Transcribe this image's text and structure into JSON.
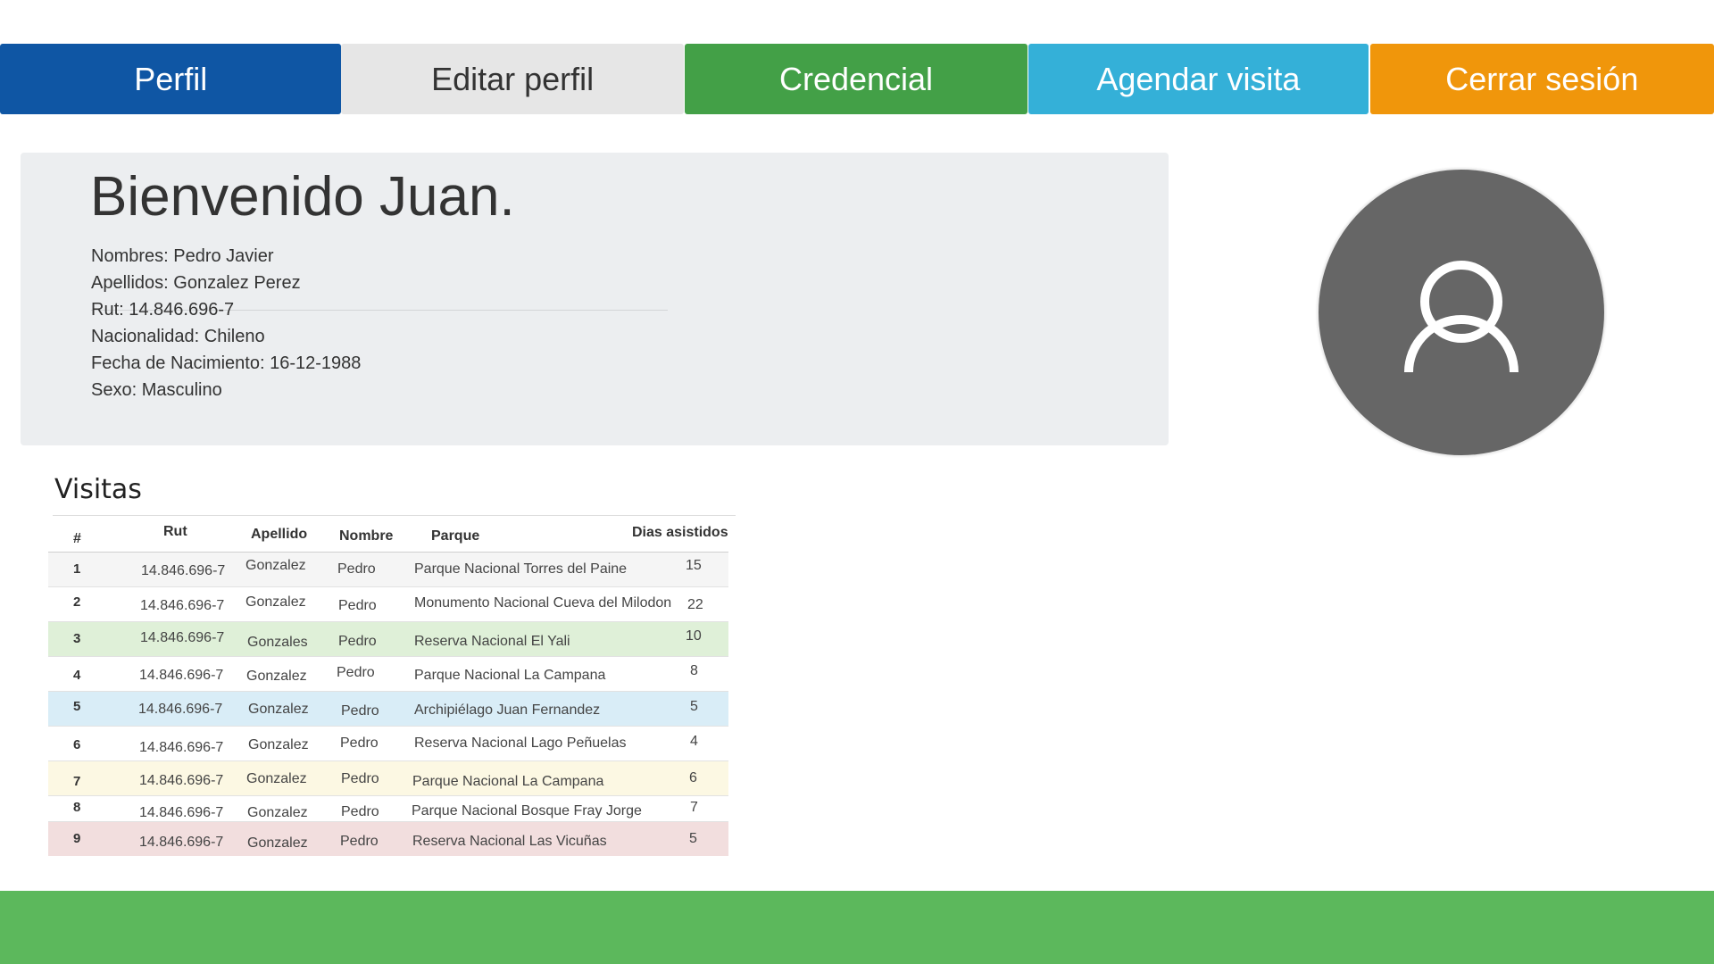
{
  "nav": {
    "perfil": "Perfil",
    "editar_perfil": "Editar perfil",
    "credencial": "Credencial",
    "agendar_visita": "Agendar visita",
    "cerrar_sesion": "Cerrar sesión"
  },
  "colors": {
    "perfil": "#0f56a4",
    "editar_perfil": "#e6e6e6",
    "credencial": "#43a047",
    "agendar_visita": "#34b0d8",
    "cerrar_sesion": "#f0960b",
    "footer": "#5cb85c"
  },
  "profile": {
    "welcome": "Bienvenido Juan.",
    "nombres": "Nombres: Pedro Javier",
    "apellidos": "Apellidos: Gonzalez Perez",
    "rut": "Rut: 14.846.696-7",
    "nacionalidad": "Nacionalidad: Chileno",
    "fecha_nacimiento": "Fecha de Nacimiento: 16-12-1988",
    "sexo": "Sexo: Masculino"
  },
  "avatar_icon": "user-icon",
  "visitas": {
    "title": "Visitas",
    "headers": {
      "num": "#",
      "rut": "Rut",
      "apellido": "Apellido",
      "nombre": "Nombre",
      "parque": "Parque",
      "dias": "Dias asistidos"
    },
    "rows": [
      {
        "num": "1",
        "rut": "14.846.696-7",
        "apellido": "Gonzalez",
        "nombre": "Pedro",
        "parque": "Parque Nacional Torres del Paine",
        "dias": "15"
      },
      {
        "num": "2",
        "rut": "14.846.696-7",
        "apellido": "Gonzalez",
        "nombre": "Pedro",
        "parque": "Monumento Nacional Cueva del Milodon",
        "dias": "22"
      },
      {
        "num": "3",
        "rut": "14.846.696-7",
        "apellido": "Gonzales",
        "nombre": "Pedro",
        "parque": "Reserva Nacional El Yali",
        "dias": "10"
      },
      {
        "num": "4",
        "rut": "14.846.696-7",
        "apellido": "Gonzalez",
        "nombre": "Pedro",
        "parque": "Parque Nacional La Campana",
        "dias": "8"
      },
      {
        "num": "5",
        "rut": "14.846.696-7",
        "apellido": "Gonzalez",
        "nombre": "Pedro",
        "parque": "Archipiélago Juan Fernandez",
        "dias": "5"
      },
      {
        "num": "6",
        "rut": "14.846.696-7",
        "apellido": "Gonzalez",
        "nombre": "Pedro",
        "parque": "Reserva Nacional Lago Peñuelas",
        "dias": "4"
      },
      {
        "num": "7",
        "rut": "14.846.696-7",
        "apellido": "Gonzalez",
        "nombre": "Pedro",
        "parque": "Parque Nacional La Campana",
        "dias": "6"
      },
      {
        "num": "8",
        "rut": "14.846.696-7",
        "apellido": "Gonzalez",
        "nombre": "Pedro",
        "parque": "Parque Nacional Bosque Fray Jorge",
        "dias": "7"
      },
      {
        "num": "9",
        "rut": "14.846.696-7",
        "apellido": "Gonzalez",
        "nombre": "Pedro",
        "parque": "Reserva Nacional Las Vicuñas",
        "dias": "5"
      }
    ]
  }
}
